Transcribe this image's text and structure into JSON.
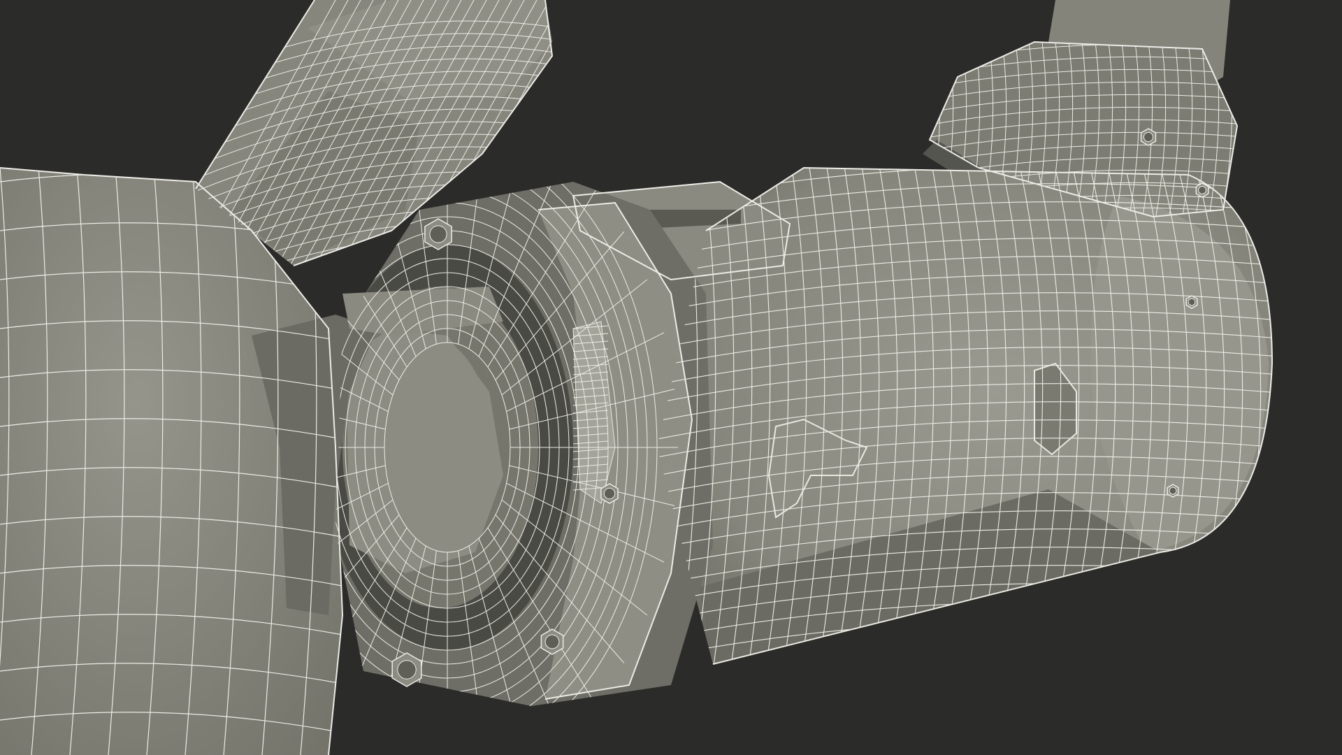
{
  "scene": {
    "subject": "robotic-arm-joint-wireframe",
    "background_color": "#2b2b2a",
    "surface_color": "#8c8c82",
    "surface_shadow_color": "#5f5f58",
    "surface_dark_color": "#3e3e3a",
    "wire_color": "#ecece6"
  }
}
